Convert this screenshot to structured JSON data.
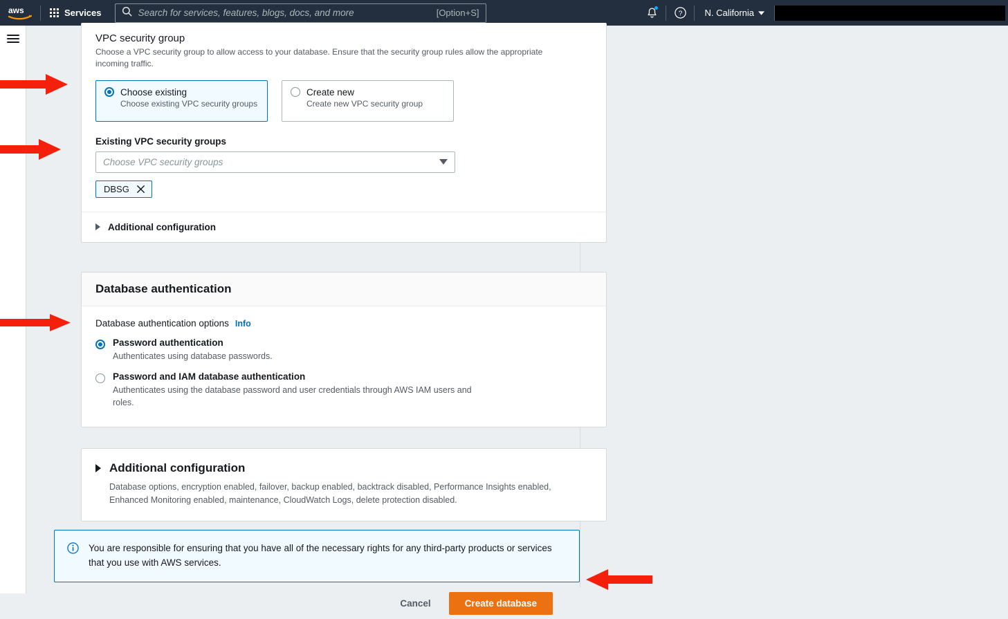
{
  "topnav": {
    "logo_alt": "aws",
    "services_label": "Services",
    "search_placeholder": "Search for services, features, blogs, docs, and more",
    "search_value": "",
    "search_shortcut": "[Option+S]",
    "region_label": "N. California",
    "account_redacted": ""
  },
  "vpc_security_group": {
    "title": "VPC security group",
    "description": "Choose a VPC security group to allow access to your database. Ensure that the security group rules allow the appropriate incoming traffic.",
    "options": [
      {
        "title": "Choose existing",
        "sub": "Choose existing VPC security groups",
        "selected": true
      },
      {
        "title": "Create new",
        "sub": "Create new VPC security group",
        "selected": false
      }
    ],
    "existing_label": "Existing VPC security groups",
    "existing_placeholder": "Choose VPC security groups",
    "existing_value": "",
    "tokens": [
      {
        "label": "DBSG"
      }
    ],
    "additional_configuration_label": "Additional configuration"
  },
  "database_authentication": {
    "section_title": "Database authentication",
    "options_label": "Database authentication options",
    "info_label": "Info",
    "options": [
      {
        "title": "Password authentication",
        "desc": "Authenticates using database passwords.",
        "selected": true
      },
      {
        "title": "Password and IAM database authentication",
        "desc": "Authenticates using the database password and user credentials through AWS IAM users and roles.",
        "selected": false
      }
    ]
  },
  "additional_configuration": {
    "title": "Additional configuration",
    "description": "Database options, encryption enabled, failover, backup enabled, backtrack disabled, Performance Insights enabled, Enhanced Monitoring enabled, maintenance, CloudWatch Logs, delete protection disabled."
  },
  "alert": {
    "icon": "info-circle-icon",
    "text": "You are responsible for ensuring that you have all of the necessary rights for any third-party products or services that you use with AWS services."
  },
  "footer": {
    "cancel_label": "Cancel",
    "create_label": "Create database"
  },
  "colors": {
    "nav_bg": "#232f3e",
    "accent_blue": "#0073bb",
    "accent_orange": "#ec7211",
    "page_bg": "#eceff1",
    "annotation_red": "#f5200c"
  }
}
